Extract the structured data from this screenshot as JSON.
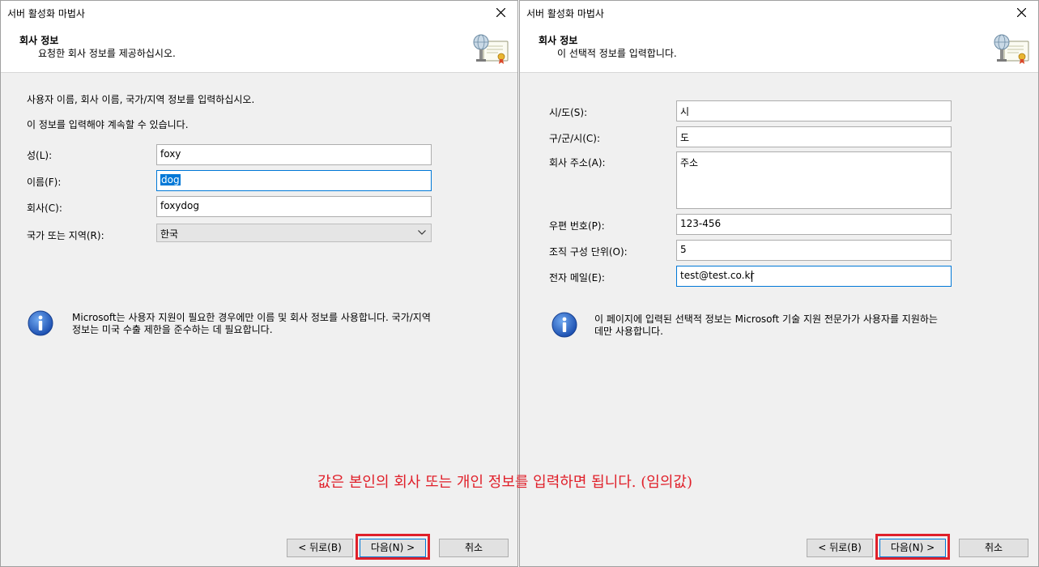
{
  "left": {
    "window_title": "서버 활성화 마법사",
    "header_title": "회사 정보",
    "header_subtitle": "요청한 회사 정보를 제공하십시오.",
    "instruction1": "사용자 이름, 회사 이름, 국가/지역 정보를 입력하십시오.",
    "instruction2": "이 정보를 입력해야 계속할 수 있습니다.",
    "labels": {
      "last_name": "성(L):",
      "first_name": "이름(F):",
      "company": "회사(C):",
      "country": "국가 또는 지역(R):"
    },
    "values": {
      "last_name": "foxy",
      "first_name": "dog",
      "company": "foxydog",
      "country": "한국"
    },
    "info_line1": "Microsoft는 사용자 지원이 필요한 경우에만 이름 및 회사 정보를 사용합니다. 국가/지역",
    "info_line2": "정보는 미국 수출 제한을 준수하는 데 필요합니다.",
    "buttons": {
      "back": "< 뒤로(B)",
      "next": "다음(N) >",
      "cancel": "취소"
    }
  },
  "right": {
    "window_title": "서버 활성화 마법사",
    "header_title": "회사 정보",
    "header_subtitle": "이 선택적 정보를 입력합니다.",
    "labels": {
      "state": "시/도(S):",
      "city": "구/군/시(C):",
      "address": "회사 주소(A):",
      "postal": "우편 번호(P):",
      "org_unit": "조직 구성 단위(O):",
      "email": "전자 메일(E):"
    },
    "values": {
      "state": "시",
      "city": "도",
      "address": "주소",
      "postal": "123-456",
      "org_unit": "5",
      "email": "test@test.co.kr"
    },
    "info_line1": "이 페이지에 입력된 선택적 정보는 Microsoft 기술 지원 전문가가 사용자를 지원하는",
    "info_line2": "데만 사용합니다.",
    "buttons": {
      "back": "< 뒤로(B)",
      "next": "다음(N) >",
      "cancel": "취소"
    }
  },
  "annotation": "값은 본인의 회사 또는 개인 정보를 입력하면 됩니다. (임의값)",
  "colors": {
    "highlight": "#e0202a",
    "focus": "#0078d7",
    "dialog_bg": "#f0f0f0"
  }
}
